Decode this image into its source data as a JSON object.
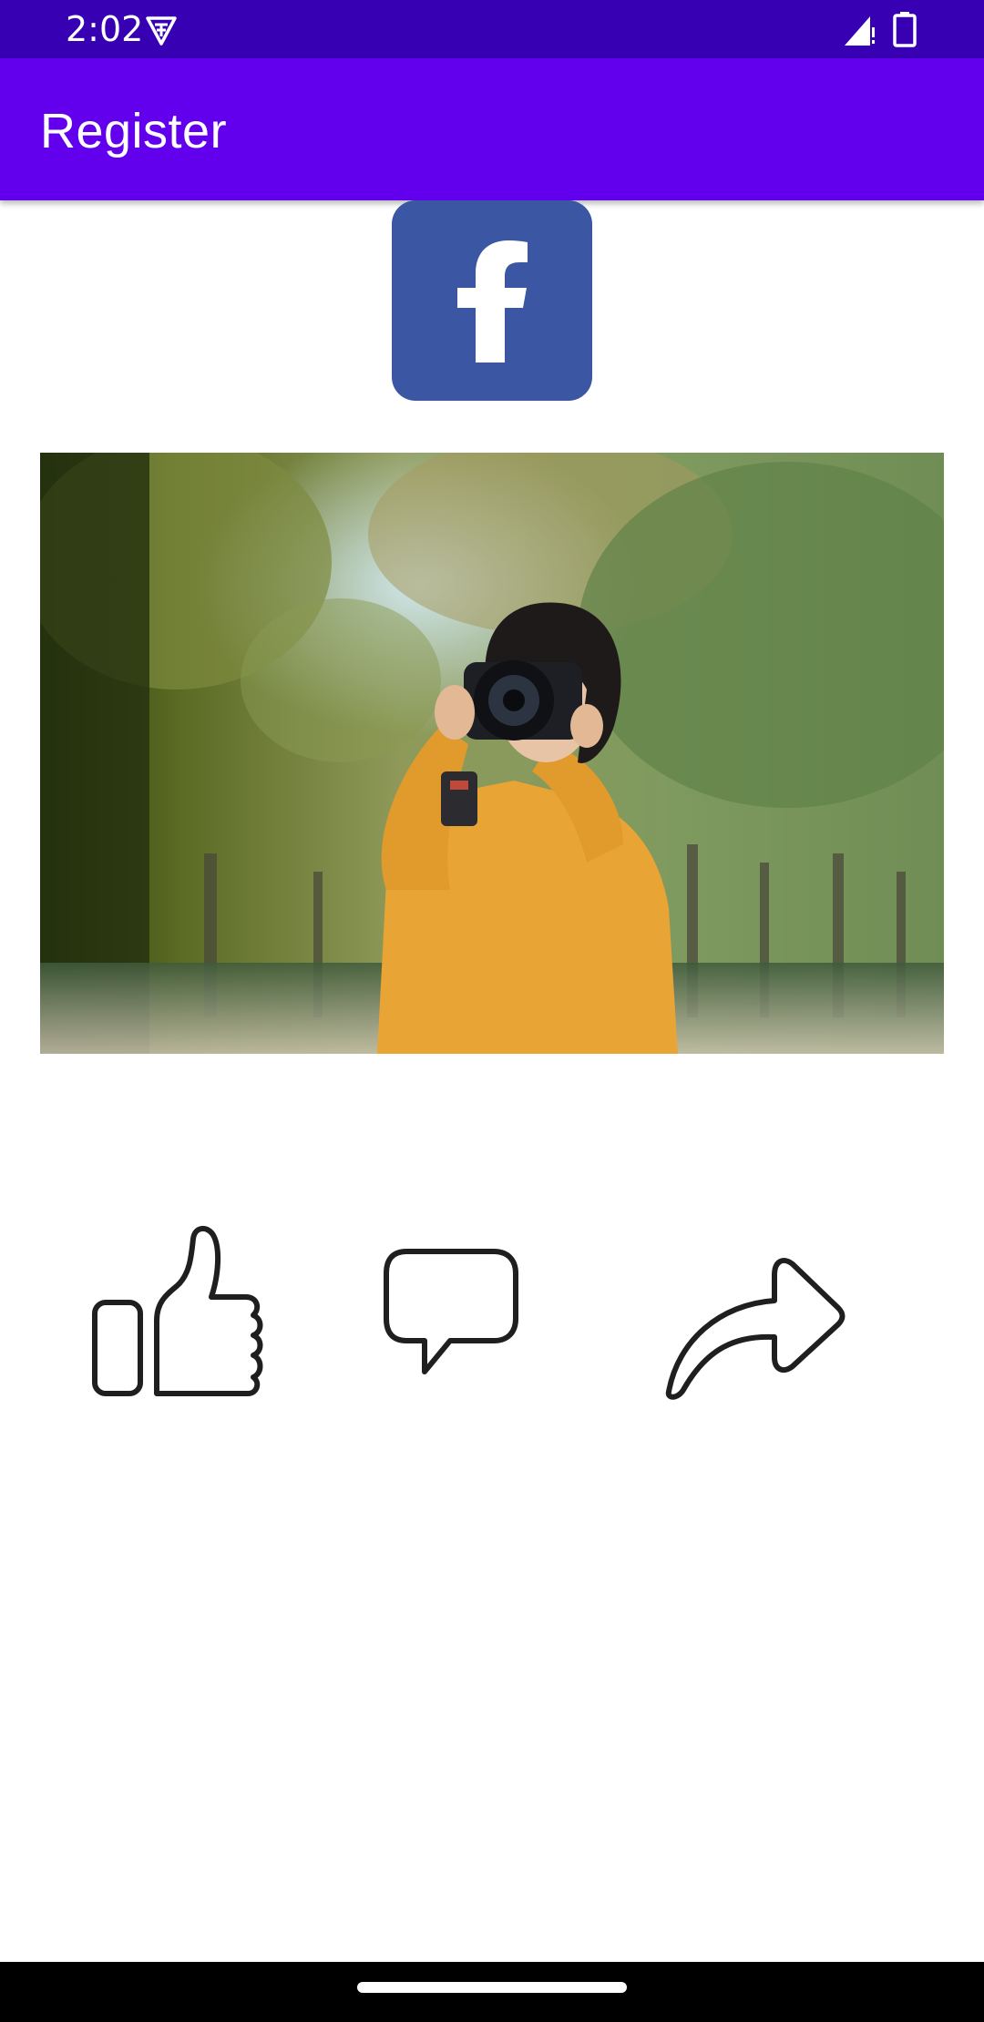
{
  "status_bar": {
    "time": "2:02",
    "background": "#3700b3",
    "icons": [
      "vpn-key-icon",
      "signal-icon",
      "battery-icon"
    ]
  },
  "app_bar": {
    "title": "Register",
    "background": "#6200ee"
  },
  "logo": {
    "icon": "facebook-logo-icon",
    "color": "#3b57a4"
  },
  "post": {
    "photo_subject": "woman-with-camera",
    "actions": [
      {
        "icon": "thumbs-up-icon"
      },
      {
        "icon": "comment-icon"
      },
      {
        "icon": "share-icon"
      }
    ]
  },
  "nav_bar": {
    "background": "#000000"
  }
}
